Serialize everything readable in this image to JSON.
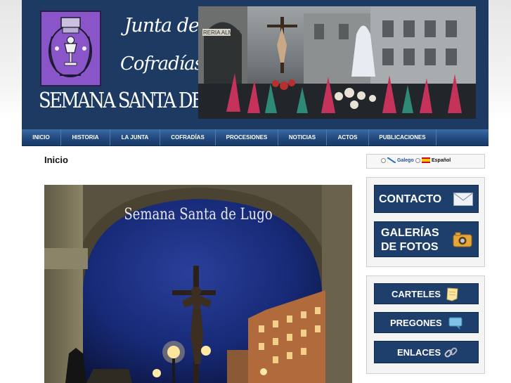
{
  "header": {
    "title_line1": "Junta de",
    "title_line2": "Cofradías",
    "title_line3": "SEMANA SANTA DE LUGO",
    "photo_sign": "RERIA ALMES"
  },
  "nav": {
    "items": [
      {
        "label": "INICIO"
      },
      {
        "label": "HISTORIA"
      },
      {
        "label": "LA JUNTA"
      },
      {
        "label": "COFRADÍAS"
      },
      {
        "label": "PROCESIONES"
      },
      {
        "label": "NOTICIAS"
      },
      {
        "label": "ACTOS"
      },
      {
        "label": "PUBLICACIONES"
      }
    ]
  },
  "main": {
    "page_title": "Inicio",
    "photo_caption": "Semana Santa de Lugo"
  },
  "sidebar": {
    "languages": [
      {
        "label": "Galego",
        "color": "#1f4f9a"
      },
      {
        "label": "Español",
        "color": "#111111"
      }
    ],
    "contacto_label": "CONTACTO",
    "galerias_label": "GALERÍAS",
    "fotos_label": "DE FOTOS",
    "carteles_label": "CARTELES",
    "pregones_label": "PREGONES",
    "enlaces_label": "ENLACES"
  },
  "colors": {
    "header_bg": "#1d3a63",
    "nav_bg": "#22497c",
    "button_bg": "#1e3f6c",
    "logo_purple": "#8a55c8"
  },
  "icons": [
    "envelope-icon",
    "camera-icon",
    "note-icon",
    "speech-bubble-icon",
    "chain-link-icon",
    "flag-galicia-icon",
    "flag-spain-icon"
  ]
}
